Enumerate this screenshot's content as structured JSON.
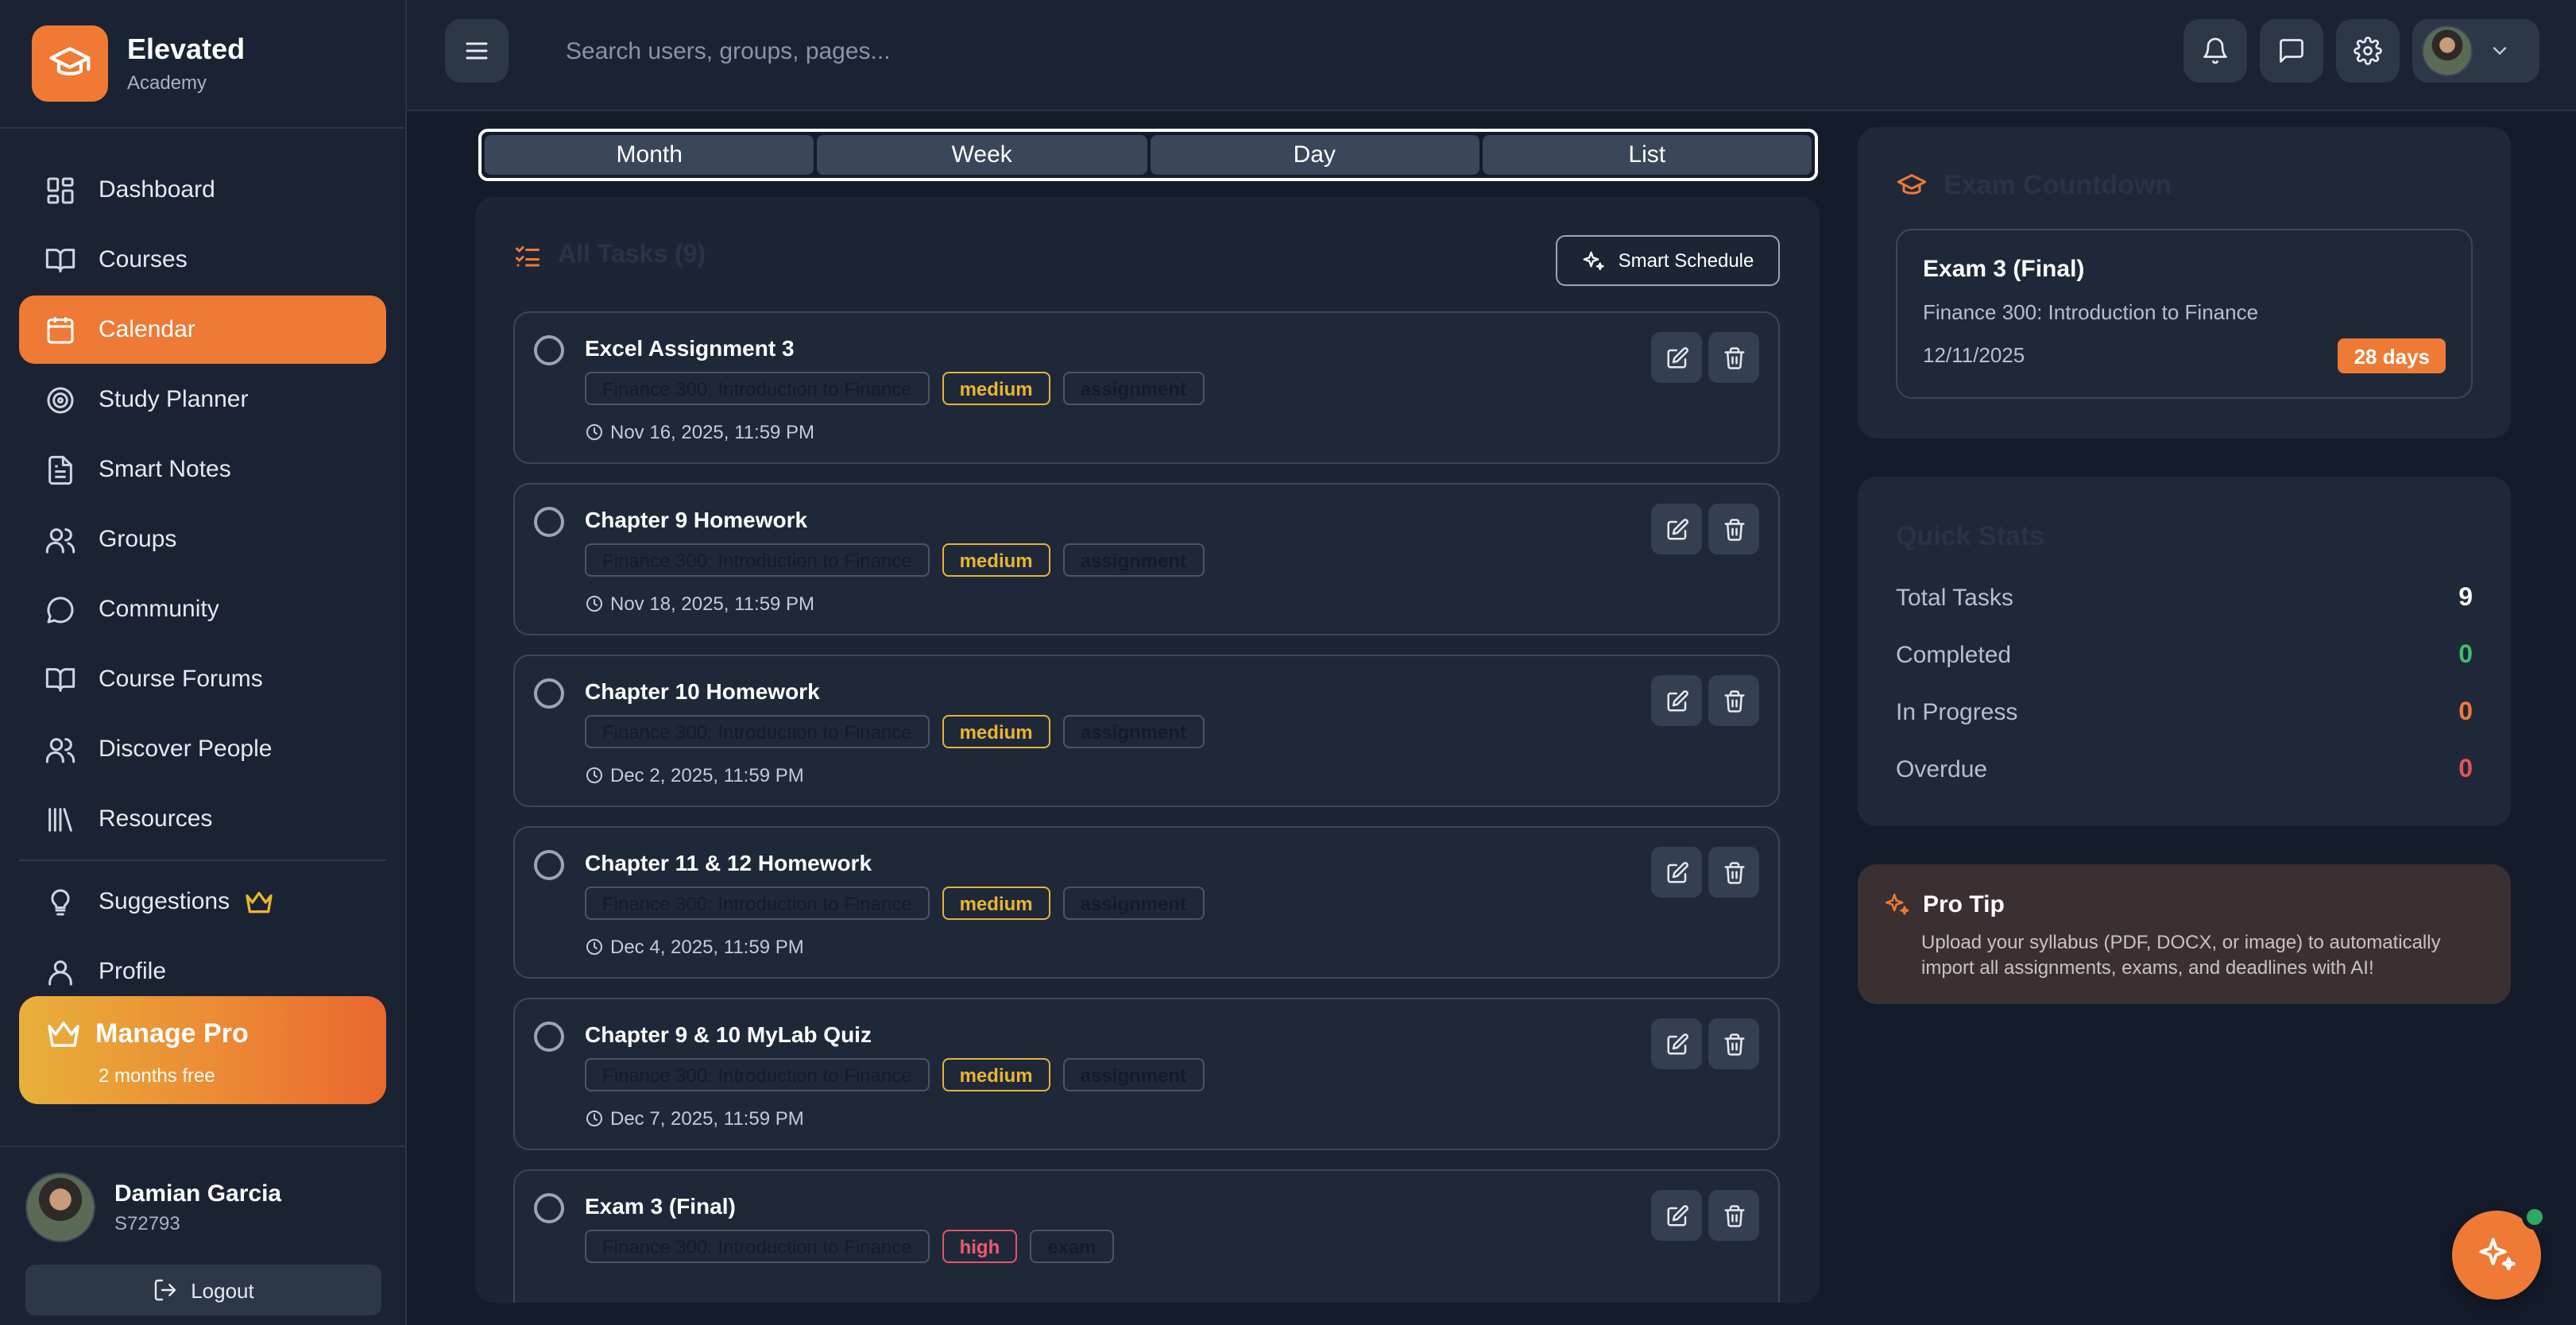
{
  "brand": {
    "name": "Elevated",
    "subtitle": "Academy"
  },
  "nav": {
    "items": [
      {
        "label": "Dashboard",
        "icon": "dashboard-icon"
      },
      {
        "label": "Courses",
        "icon": "book-open-icon"
      },
      {
        "label": "Calendar",
        "icon": "calendar-icon",
        "active": true
      },
      {
        "label": "Study Planner",
        "icon": "target-icon"
      },
      {
        "label": "Smart Notes",
        "icon": "file-text-icon"
      },
      {
        "label": "Groups",
        "icon": "users-icon"
      },
      {
        "label": "Community",
        "icon": "message-circle-icon"
      },
      {
        "label": "Course Forums",
        "icon": "book-open-icon"
      },
      {
        "label": "Discover People",
        "icon": "users-icon"
      },
      {
        "label": "Resources",
        "icon": "library-icon"
      }
    ],
    "secondary": [
      {
        "label": "Suggestions",
        "icon": "lightbulb-icon"
      },
      {
        "label": "Profile",
        "icon": "user-icon"
      }
    ]
  },
  "pro": {
    "title": "Manage Pro",
    "subtitle": "2 months free"
  },
  "user": {
    "name": "Damian Garcia",
    "id": "S72793",
    "logout_label": "Logout"
  },
  "header": {
    "search_placeholder": "Search users, groups, pages..."
  },
  "view_tabs": [
    "Month",
    "Week",
    "Day",
    "List"
  ],
  "tasks": {
    "title": "All Tasks (9)",
    "smart_schedule_label": "Smart Schedule",
    "items": [
      {
        "title": "Excel Assignment 3",
        "course": "Finance 300: Introduction to Finance",
        "priority": "medium",
        "type": "assignment",
        "due": "Nov 16, 2025, 11:59 PM"
      },
      {
        "title": "Chapter 9 Homework",
        "course": "Finance 300: Introduction to Finance",
        "priority": "medium",
        "type": "assignment",
        "due": "Nov 18, 2025, 11:59 PM"
      },
      {
        "title": "Chapter 10 Homework",
        "course": "Finance 300: Introduction to Finance",
        "priority": "medium",
        "type": "assignment",
        "due": "Dec 2, 2025, 11:59 PM"
      },
      {
        "title": "Chapter 11 & 12 Homework",
        "course": "Finance 300: Introduction to Finance",
        "priority": "medium",
        "type": "assignment",
        "due": "Dec 4, 2025, 11:59 PM"
      },
      {
        "title": "Chapter 9 & 10 MyLab Quiz",
        "course": "Finance 300: Introduction to Finance",
        "priority": "medium",
        "type": "assignment",
        "due": "Dec 7, 2025, 11:59 PM"
      },
      {
        "title": "Exam 3 (Final)",
        "course": "Finance 300: Introduction to Finance",
        "priority": "high",
        "type": "exam",
        "due": ""
      }
    ]
  },
  "exam_countdown": {
    "title": "Exam Countdown",
    "exam_name": "Exam 3 (Final)",
    "course": "Finance 300: Introduction to Finance",
    "date": "12/11/2025",
    "days_left": "28 days"
  },
  "quick_stats": {
    "title": "Quick Stats",
    "rows": [
      {
        "label": "Total Tasks",
        "value": "9",
        "color": "#ffffff"
      },
      {
        "label": "Completed",
        "value": "0",
        "color": "#3fbf6a"
      },
      {
        "label": "In Progress",
        "value": "0",
        "color": "#ee7a35"
      },
      {
        "label": "Overdue",
        "value": "0",
        "color": "#e7505c"
      }
    ]
  },
  "pro_tip": {
    "title": "Pro Tip",
    "text": "Upload your syllabus (PDF, DOCX, or image) to automatically import all assignments, exams, and deadlines with AI!"
  },
  "colors": {
    "accent": "#ee7a35",
    "bg": "#141b2b",
    "panel": "#1c2536"
  }
}
